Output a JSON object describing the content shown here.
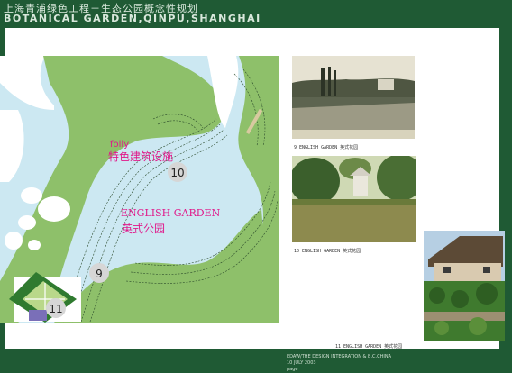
{
  "header": {
    "title_cn": "上海青浦绿色工程－生态公园概念性规划",
    "title_en": "BOTANICAL GARDEN,QINPU,SHANGHAI"
  },
  "map": {
    "label_folly": "folly",
    "label_folly_cn": "特色建筑设施",
    "label_garden_en": "ENGLISH GARDEN",
    "label_garden_cn": "英式公园",
    "markers": [
      "10",
      "9",
      "11"
    ]
  },
  "photos": [
    {
      "caption": "9  ENGLISH GARDEN  英式花园"
    },
    {
      "caption": "10  ENGLISH GARDEN  英式花园"
    },
    {
      "caption": "11 ENGLISH GARDEN  英式花园"
    }
  ],
  "footer": {
    "line1": "EDAW/THE DESIGN INTEGRATION & B.C.CHINA",
    "line2": "10 JULY 2003",
    "line3": "page"
  },
  "colors": {
    "frame": "#1f5a34",
    "water": "#cce8f2",
    "lawn": "#8ec06a",
    "label_pink": "#e0198a"
  }
}
